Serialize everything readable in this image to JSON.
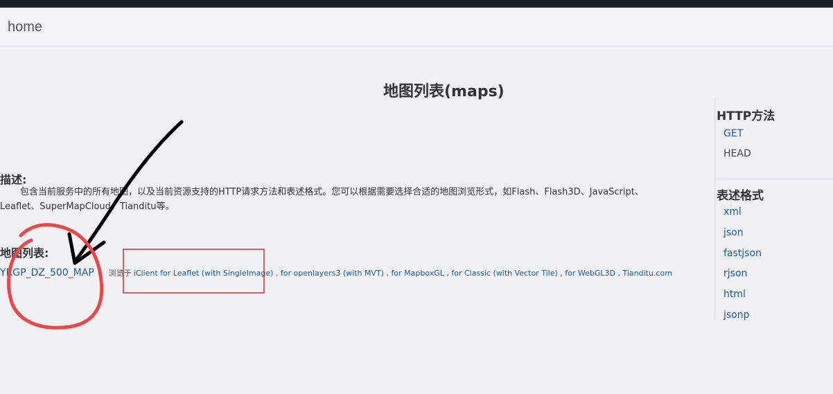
{
  "navbar": {
    "brand": "home"
  },
  "page": {
    "title": "地图列表(maps)"
  },
  "description": {
    "heading": "描述:",
    "line1": "包含当前服务中的所有地图，以及当前资源支持的HTTP请求方法和表述格式。您可以根据需要选择合适的地图浏览形式，如Flash、Flash3D、JavaScript、",
    "line2": "Leaflet、SuperMapCloud、Tianditu等。"
  },
  "map_list": {
    "heading": "地图列表:",
    "maps": [
      {
        "name": "YRGP_DZ_500_MAP",
        "browse_label": "浏览于",
        "clients": [
          "iClient for Leaflet (with SingleImage)",
          "for openlayers3 (with MVT)",
          "for MapboxGL",
          "for Classic (with Vector Tile)",
          "for WebGL3D",
          "Tianditu.com"
        ],
        "separator": ","
      }
    ]
  },
  "sidebar": {
    "http_methods": {
      "heading": "HTTP方法",
      "items": [
        "GET",
        "HEAD"
      ]
    },
    "formats": {
      "heading": "表述格式",
      "items": [
        "xml",
        "json",
        "fastjson",
        "rjson",
        "html",
        "jsonp"
      ]
    }
  },
  "annotations": {
    "arrow_color": "#000000",
    "circle_color": "#e8484a",
    "box_color": "#d22b2b"
  }
}
